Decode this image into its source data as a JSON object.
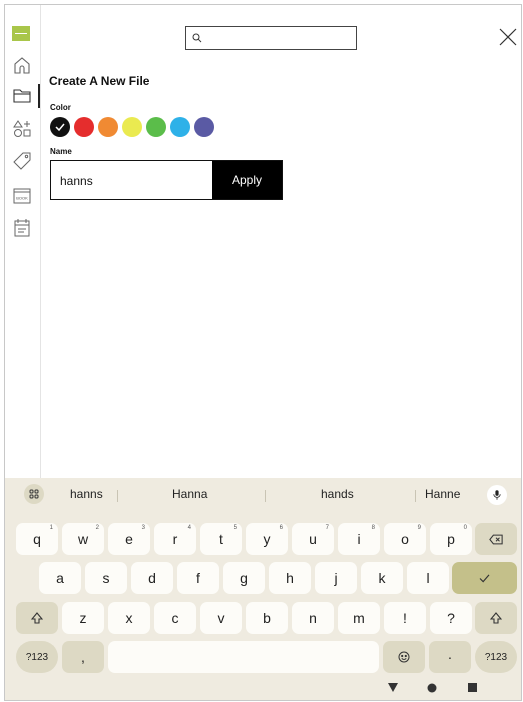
{
  "search": {
    "placeholder": ""
  },
  "panel": {
    "title": "Create A New File",
    "color_label": "Color",
    "name_label": "Name",
    "name_value": "hanns",
    "apply_label": "Apply"
  },
  "colors": [
    "#111111",
    "#e52d2d",
    "#f08a33",
    "#eaea50",
    "#5bbd4a",
    "#2eb1e8",
    "#5a5aa4"
  ],
  "selected_color_index": 0,
  "sidebar_icons": [
    "logo",
    "home-icon",
    "folder-icon",
    "shapes-icon",
    "tag-icon",
    "book-icon",
    "calendar-icon"
  ],
  "sidebar_book_text": "BOOK",
  "keyboard": {
    "suggestions": [
      "hanns",
      "Hanna",
      "hands",
      "Hanne"
    ],
    "row1": [
      "q",
      "w",
      "e",
      "r",
      "t",
      "y",
      "u",
      "i",
      "o",
      "p"
    ],
    "row1_hints": [
      "1",
      "2",
      "3",
      "4",
      "5",
      "6",
      "7",
      "8",
      "9",
      "0"
    ],
    "row2": [
      "a",
      "s",
      "d",
      "f",
      "g",
      "h",
      "j",
      "k",
      "l"
    ],
    "row3": [
      "z",
      "x",
      "c",
      "v",
      "b",
      "n",
      "m",
      "!",
      "?"
    ],
    "mode_key": "?123",
    "comma_key": ",",
    "period_key": "·"
  }
}
